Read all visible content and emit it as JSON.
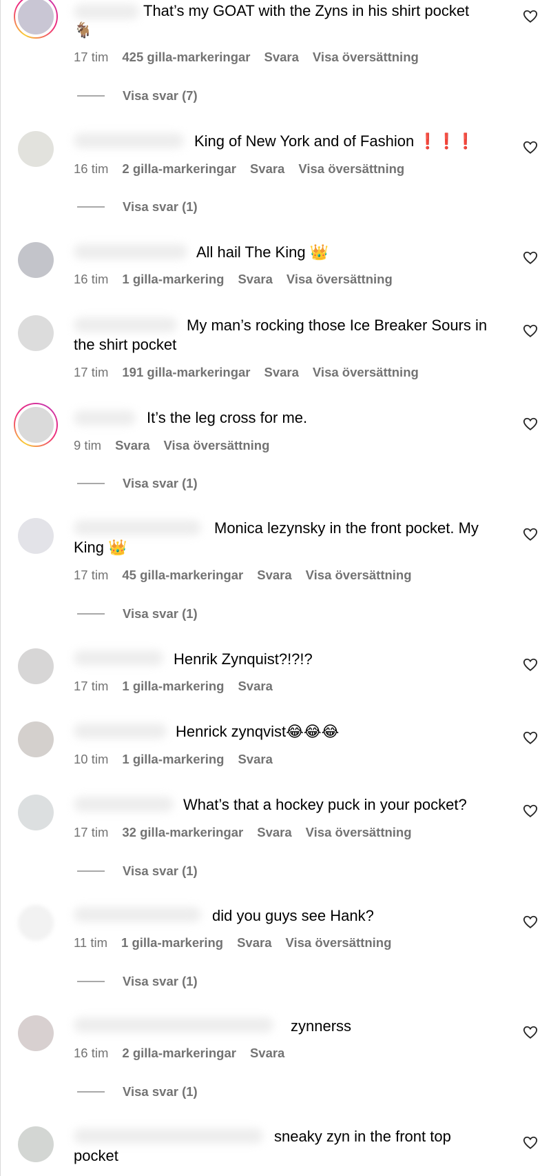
{
  "comments": [
    {
      "text": "That’s my GOAT with the Zyns in his shirt pocket",
      "text2": "🐐",
      "time": "17 tim",
      "likes": "425 gilla-markeringar",
      "reply": "Svara",
      "translate": "Visa översättning",
      "view_replies": "Visa svar (7)"
    },
    {
      "text": "King of New York and of Fashion",
      "text_emoji": "❗❗❗",
      "time": "16 tim",
      "likes": "2 gilla-markeringar",
      "reply": "Svara",
      "translate": "Visa översättning",
      "view_replies": "Visa svar (1)"
    },
    {
      "text": "All hail The King",
      "text_emoji": "👑",
      "time": "16 tim",
      "likes": "1 gilla-markering",
      "reply": "Svara",
      "translate": "Visa översättning"
    },
    {
      "text": "My man’s rocking those Ice Breaker Sours in",
      "text2": "the shirt pocket",
      "time": "17 tim",
      "likes": "191 gilla-markeringar",
      "reply": "Svara",
      "translate": "Visa översättning"
    },
    {
      "text": "It’s the leg cross for me.",
      "time": "9 tim",
      "reply": "Svara",
      "translate": "Visa översättning",
      "view_replies": "Visa svar (1)"
    },
    {
      "text": "Monica lezynsky in the front pocket. My",
      "text2": "King",
      "text2_emoji": "👑",
      "time": "17 tim",
      "likes": "45 gilla-markeringar",
      "reply": "Svara",
      "translate": "Visa översättning",
      "view_replies": "Visa svar (1)"
    },
    {
      "text": "Henrik Zynquist?!?!?",
      "time": "17 tim",
      "likes": "1 gilla-markering",
      "reply": "Svara"
    },
    {
      "text": "Henrick zynqvist",
      "text_emoji": "😂😂😂",
      "time": "10 tim",
      "likes": "1 gilla-markering",
      "reply": "Svara"
    },
    {
      "text": "What’s that a hockey puck in your pocket?",
      "time": "17 tim",
      "likes": "32 gilla-markeringar",
      "reply": "Svara",
      "translate": "Visa översättning",
      "view_replies": "Visa svar (1)"
    },
    {
      "text": "did you guys see Hank?",
      "time": "11 tim",
      "likes": "1 gilla-markering",
      "reply": "Svara",
      "translate": "Visa översättning",
      "view_replies": "Visa svar (1)"
    },
    {
      "text": "zynnerss",
      "time": "16 tim",
      "likes": "2 gilla-markeringar",
      "reply": "Svara",
      "view_replies": "Visa svar (1)"
    },
    {
      "text": "sneaky zyn in the front top",
      "text2": "pocket"
    }
  ],
  "icons": {
    "like": "heart-outline-icon"
  },
  "colors": {
    "meta": "#737373",
    "story_ring_start": "#f9ce34",
    "story_ring_end": "#c837ab",
    "exclaim": "#e0151b"
  }
}
